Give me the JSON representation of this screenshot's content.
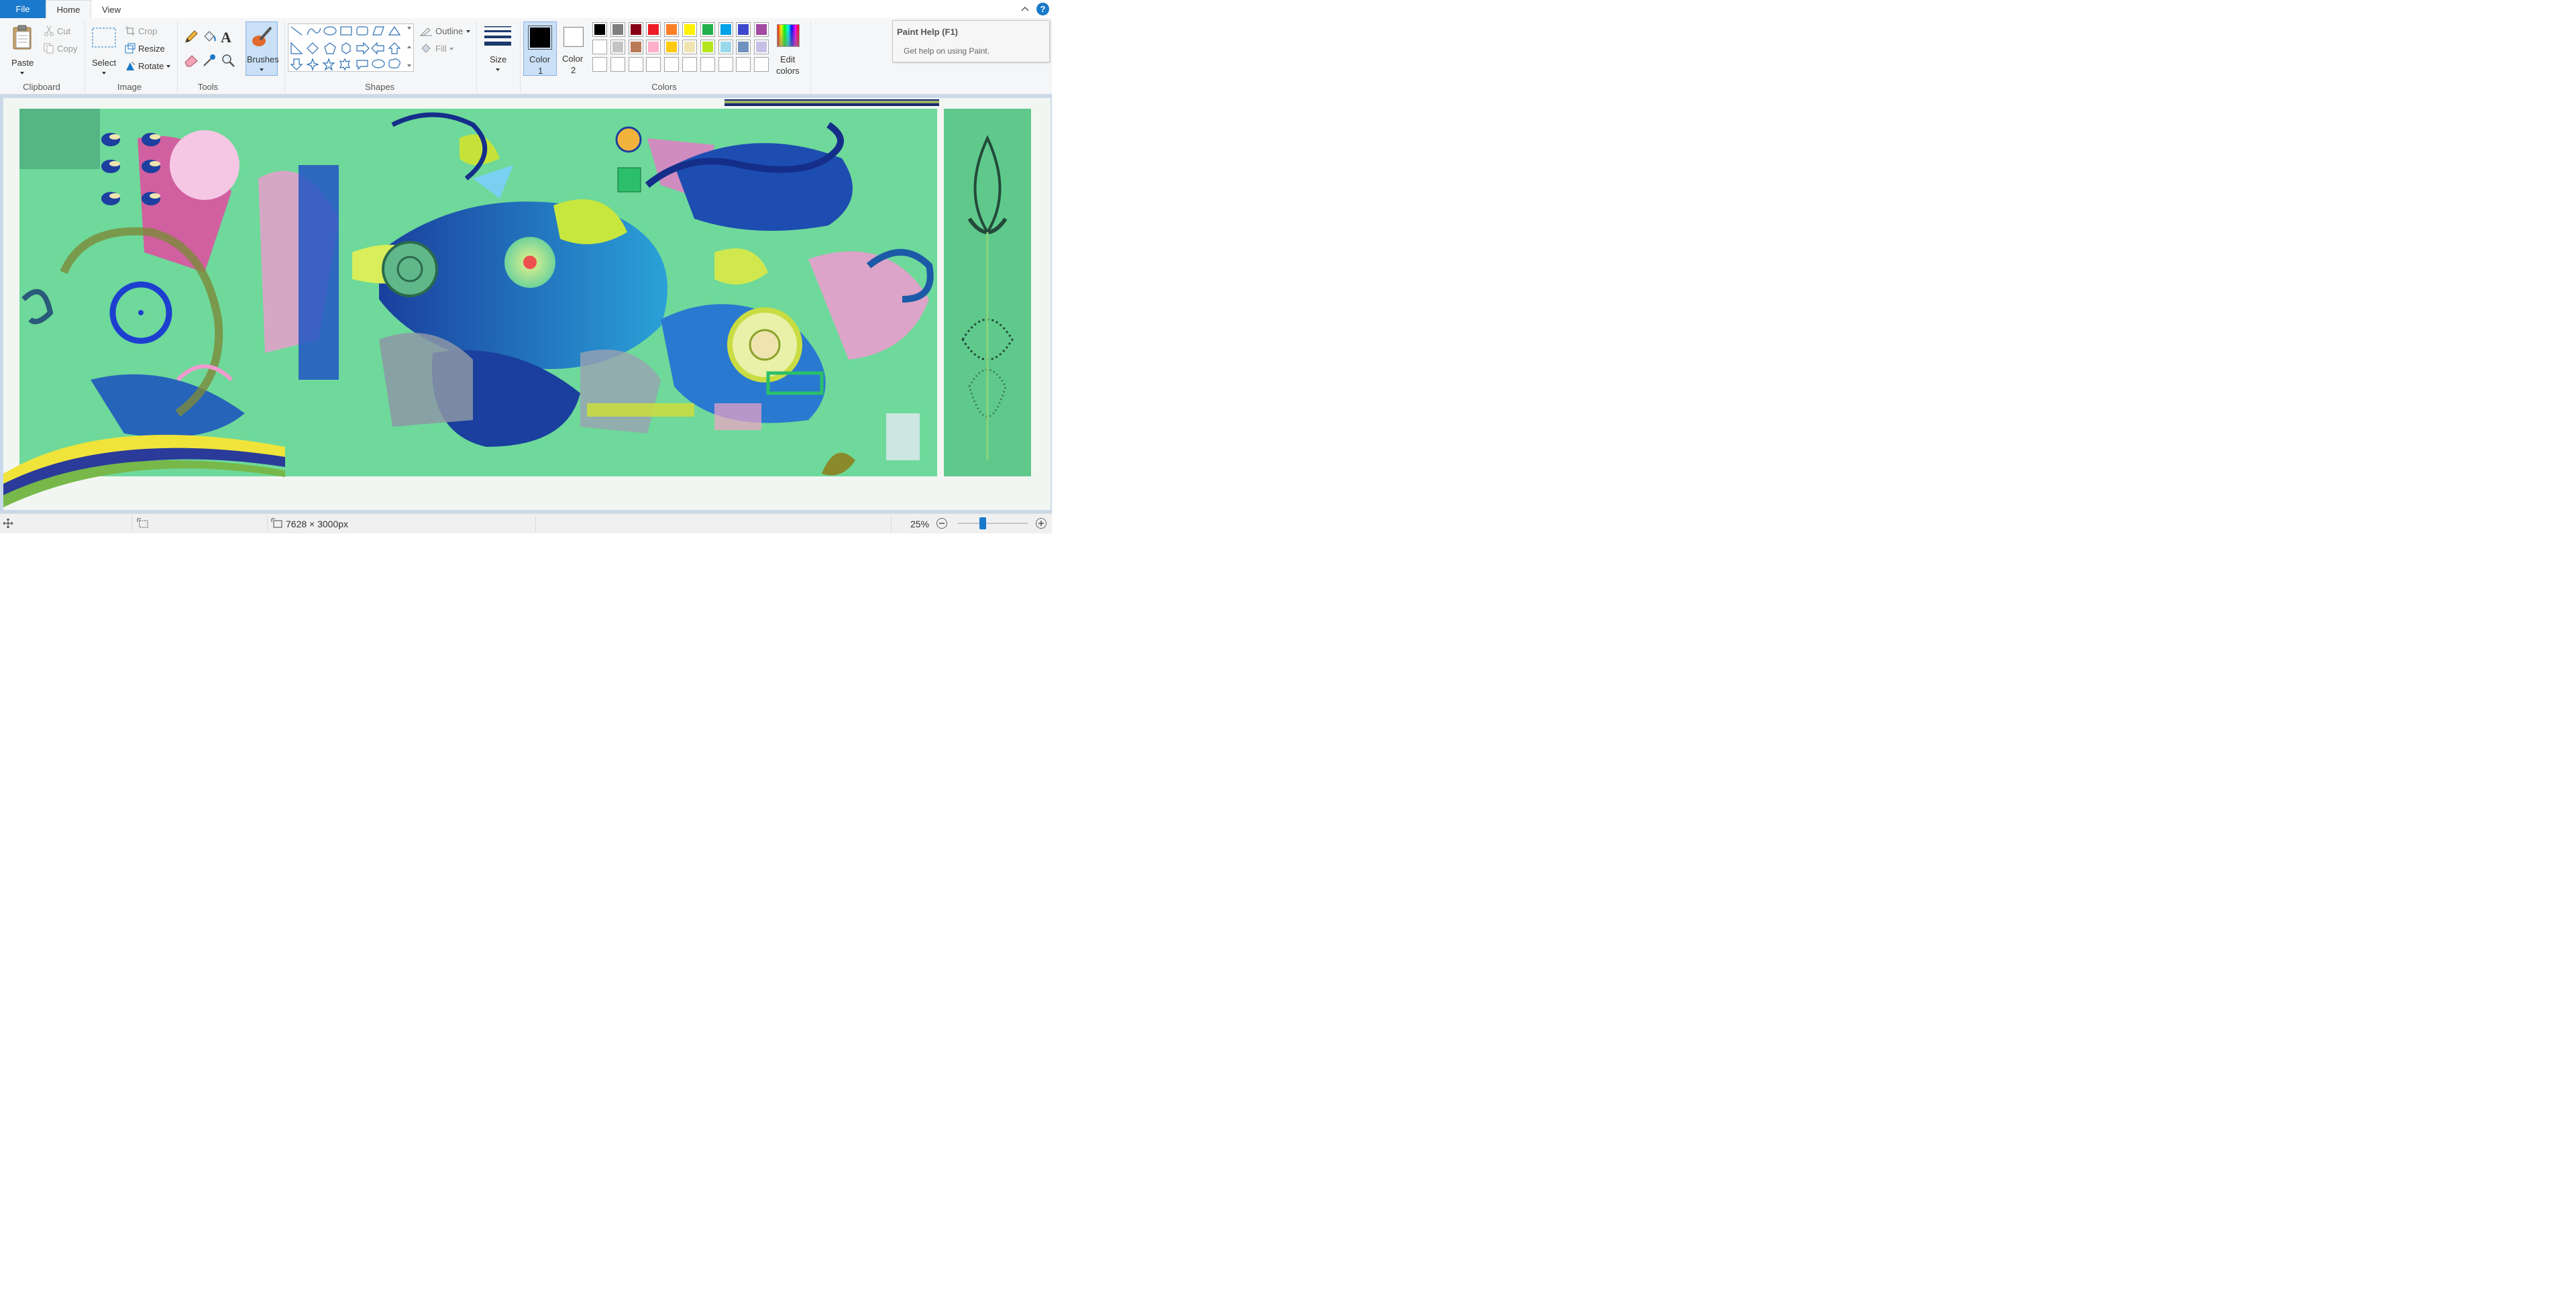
{
  "tabs": {
    "file": "File",
    "home": "Home",
    "view": "View"
  },
  "help_button": "?",
  "ribbon": {
    "clipboard": {
      "label": "Clipboard",
      "paste": "Paste",
      "cut": "Cut",
      "copy": "Copy"
    },
    "image": {
      "label": "Image",
      "select": "Select",
      "crop": "Crop",
      "resize": "Resize",
      "rotate": "Rotate"
    },
    "tools": {
      "label": "Tools"
    },
    "brushes": {
      "label": "Brushes"
    },
    "shapes": {
      "label": "Shapes",
      "outline": "Outline",
      "fill": "Fill"
    },
    "size": {
      "label": "Size"
    },
    "color1": {
      "line1": "Color",
      "line2": "1",
      "value": "#000000"
    },
    "color2": {
      "line1": "Color",
      "line2": "2",
      "value": "#ffffff"
    },
    "colors": {
      "label": "Colors",
      "edit_line1": "Edit",
      "edit_line2": "colors",
      "row1": [
        "#000000",
        "#7f7f7f",
        "#880015",
        "#ed1c24",
        "#ff7f27",
        "#fff200",
        "#22b14c",
        "#00a2e8",
        "#3f48cc",
        "#a349a4"
      ],
      "row2": [
        "#ffffff",
        "#c3c3c3",
        "#b97a57",
        "#ffaec9",
        "#ffc90e",
        "#efe4b0",
        "#b5e61d",
        "#99d9ea",
        "#7092be",
        "#c8bfe7"
      ],
      "row3": [
        "#ffffff",
        "#ffffff",
        "#ffffff",
        "#ffffff",
        "#ffffff",
        "#ffffff",
        "#ffffff",
        "#ffffff",
        "#ffffff",
        "#ffffff"
      ]
    }
  },
  "tooltip": {
    "title": "Paint Help (F1)",
    "description": "Get help on using Paint."
  },
  "status": {
    "image_size": "7628 × 3000px",
    "zoom": "25%",
    "zoom_fraction": 0.36
  }
}
